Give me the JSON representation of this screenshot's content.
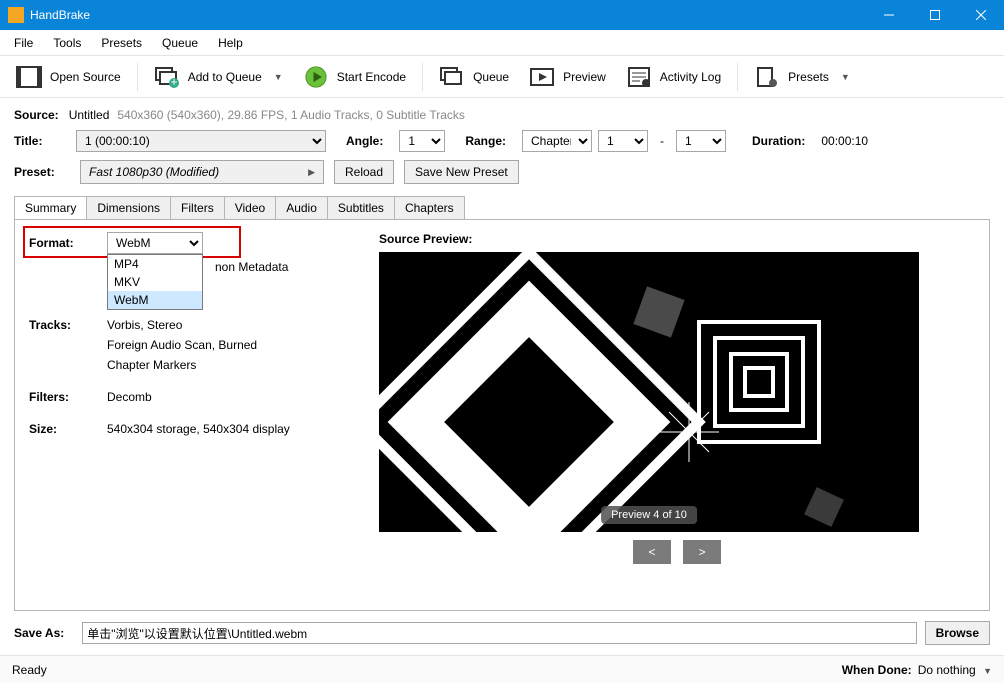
{
  "window": {
    "title": "HandBrake"
  },
  "menu": {
    "file": "File",
    "tools": "Tools",
    "presets": "Presets",
    "queue": "Queue",
    "help": "Help"
  },
  "toolbar": {
    "open_source": "Open Source",
    "add_queue": "Add to Queue",
    "start_encode": "Start Encode",
    "queue": "Queue",
    "preview": "Preview",
    "activity_log": "Activity Log",
    "presets": "Presets"
  },
  "source": {
    "label": "Source:",
    "name": "Untitled",
    "details": "540x360 (540x360), 29.86 FPS, 1 Audio Tracks, 0 Subtitle Tracks"
  },
  "title_row": {
    "title_label": "Title:",
    "title_value": "1  (00:00:10)",
    "angle_label": "Angle:",
    "angle_value": "1",
    "range_label": "Range:",
    "range_type": "Chapters",
    "range_from": "1",
    "range_to": "1",
    "duration_label": "Duration:",
    "duration_value": "00:00:10"
  },
  "preset_row": {
    "label": "Preset:",
    "value": "Fast 1080p30  (Modified)",
    "reload": "Reload",
    "save_new": "Save New Preset"
  },
  "tabs": {
    "summary": "Summary",
    "dimensions": "Dimensions",
    "filters": "Filters",
    "video": "Video",
    "audio": "Audio",
    "subtitles": "Subtitles",
    "chapters": "Chapters"
  },
  "summary": {
    "format_label": "Format:",
    "format_value": "WebM",
    "format_options": [
      "MP4",
      "MKV",
      "WebM"
    ],
    "passthru_tail": "non Metadata",
    "tracks_label": "Tracks:",
    "tracks": [
      "Vorbis, Stereo",
      "Foreign Audio Scan, Burned",
      "Chapter Markers"
    ],
    "filters_label": "Filters:",
    "filters_value": "Decomb",
    "size_label": "Size:",
    "size_value": "540x304 storage, 540x304 display",
    "preview_label": "Source Preview:",
    "preview_badge": "Preview 4 of 10",
    "prev": "<",
    "next": ">"
  },
  "save_as": {
    "label": "Save As:",
    "value": "单击\"浏览\"以设置默认位置\\Untitled.webm",
    "browse": "Browse"
  },
  "status": {
    "ready": "Ready",
    "when_done_label": "When Done:",
    "when_done_value": "Do nothing"
  }
}
